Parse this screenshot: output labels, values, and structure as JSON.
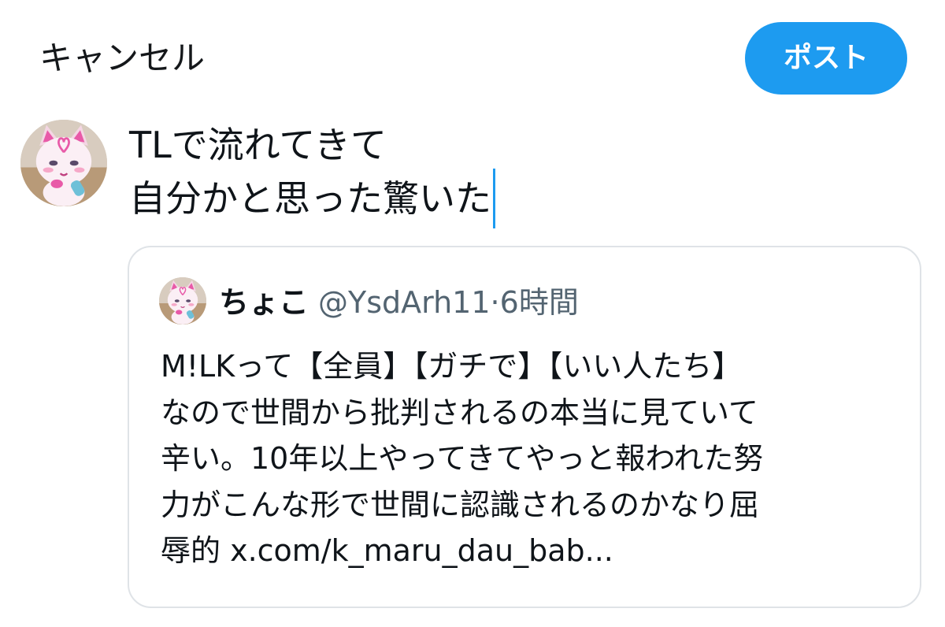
{
  "header": {
    "cancel_label": "キャンセル",
    "post_label": "ポスト"
  },
  "compose": {
    "lines": [
      "TLで流れてきて",
      "自分かと思った驚いた"
    ]
  },
  "quote": {
    "name": "ちょこ",
    "handle": "@YsdArh11",
    "separator": "·",
    "time": "6時間",
    "lines": [
      "M!LKって【全員】【ガチで】【いい人たち】",
      "なので世間から批判されるの本当に見ていて",
      "辛い。10年以上やってきてやっと報われた努",
      "力がこんな形で世間に認識されるのかなり屈",
      "辱的 x.com/k_maru_dau_bab..."
    ]
  },
  "colors": {
    "accent": "#1d9bf0",
    "text": "#0f1419",
    "secondary": "#536471",
    "border": "#dfe3e7"
  },
  "icons": {
    "main_avatar": "pink-cat-character-avatar",
    "quote_avatar": "pink-cat-character-avatar"
  }
}
